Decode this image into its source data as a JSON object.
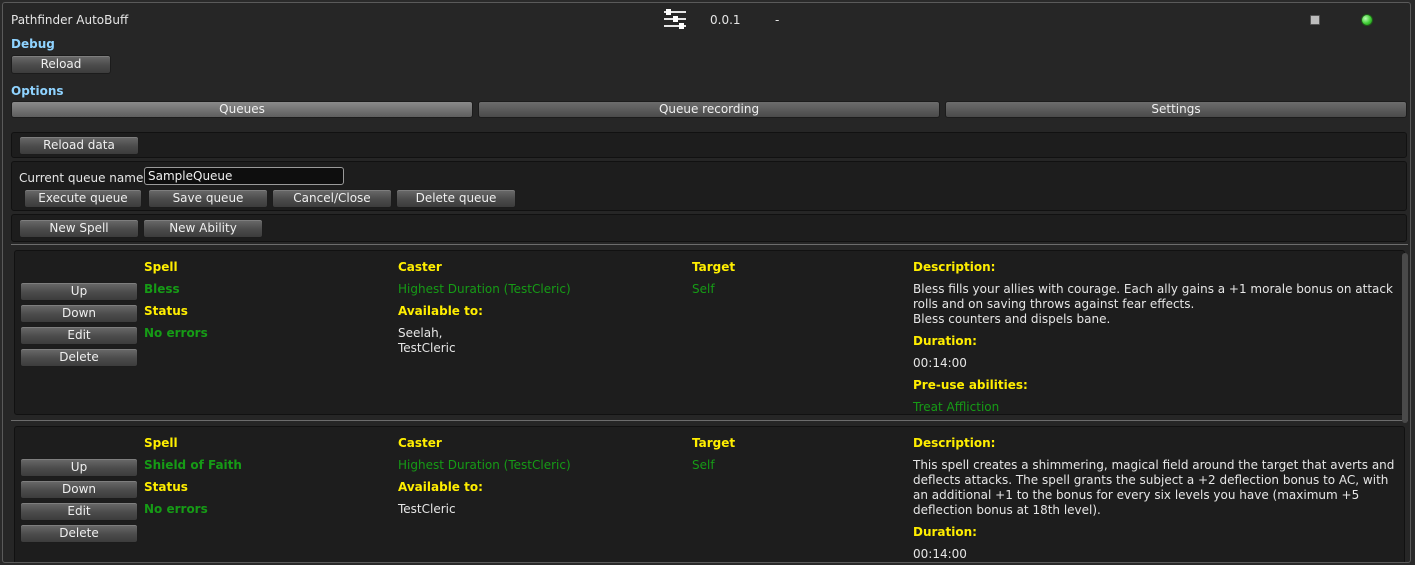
{
  "header": {
    "title": "Pathfinder AutoBuff",
    "version": "0.0.1",
    "separator": "-",
    "status_color": "#3ecb33"
  },
  "debug": {
    "label": "Debug",
    "reload_button": "Reload"
  },
  "options": {
    "label": "Options",
    "tabs": [
      "Queues",
      "Queue recording",
      "Settings"
    ],
    "active_tab": "Queues"
  },
  "queue_panel": {
    "reload_data_button": "Reload data",
    "current_queue_label": "Current queue name:",
    "current_queue_value": "SampleQueue",
    "execute_button": "Execute queue",
    "save_button": "Save queue",
    "cancel_button": "Cancel/Close",
    "delete_button": "Delete queue",
    "new_spell_button": "New Spell",
    "new_ability_button": "New Ability"
  },
  "row_buttons": {
    "up": "Up",
    "down": "Down",
    "edit": "Edit",
    "delete": "Delete"
  },
  "headers": {
    "spell": "Spell",
    "status": "Status",
    "caster": "Caster",
    "available_to": "Available to:",
    "target": "Target",
    "description": "Description:",
    "duration": "Duration:",
    "pre_use": "Pre-use abilities:"
  },
  "entries": [
    {
      "spell": "Bless",
      "status": "No errors",
      "caster": "Highest Duration (TestCleric)",
      "available_to_1": "Seelah,",
      "available_to_2": "TestCleric",
      "target": "Self",
      "description_1": "Bless fills your allies with courage. Each ally gains a +1 morale bonus on attack rolls and on saving throws against fear effects.",
      "description_2": "Bless counters and dispels bane.",
      "duration": "00:14:00",
      "pre_use": "Treat Affliction"
    },
    {
      "spell": "Shield of Faith",
      "status": "No errors",
      "caster": "Highest Duration (TestCleric)",
      "available_to_1": "TestCleric",
      "target": "Self",
      "description_1": "This spell creates a shimmering, magical field around the target that averts and deflects attacks. The spell grants the subject a +2 deflection bonus to AC, with an additional +1 to the bonus for every six levels you have (maximum +5 deflection bonus at 18th level).",
      "duration": "00:14:00"
    }
  ]
}
